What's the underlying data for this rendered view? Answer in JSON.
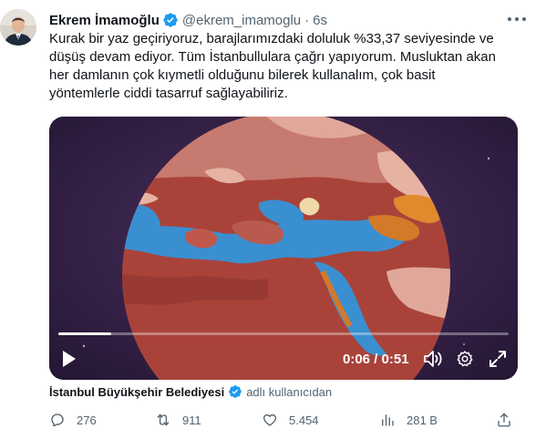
{
  "author": {
    "name": "Ekrem İmamoğlu",
    "handle": "@ekrem_imamoglu",
    "separator": "·",
    "time": "6s",
    "verified_color": "#1d9bf0"
  },
  "tweet": {
    "lines": [
      "Kurak bir yaz geçiriyoruz, barajlarımızdaki doluluk %33,37 seviyesinde ve",
      "düşüş devam ediyor. Tüm İstanbullulara çağrı yapıyorum. Musluktan akan",
      "her damlanın çok kıymetli olduğunu bilerek kullanalım, çok basit",
      "yöntemlerle ciddi tasarruf sağlayabiliriz."
    ]
  },
  "video": {
    "timecode": "0:06 / 0:51",
    "progress": 0.118,
    "icons": {
      "play": "play-icon",
      "volume": "volume-icon",
      "settings": "gear-icon",
      "fullscreen": "expand-icon"
    }
  },
  "credit": {
    "name": "İstanbul Büyükşehir Belediyesi",
    "suffix": "adlı kullanıcıdan",
    "badge_color": "#1d9bf0"
  },
  "actions": {
    "reply": "276",
    "retweet": "911",
    "like": "5.454",
    "views": "281 B",
    "icons": [
      "reply-icon",
      "retweet-icon",
      "like-icon",
      "views-icon",
      "share-icon"
    ]
  },
  "colors": {
    "text": "#0f1419",
    "muted": "#536471",
    "accent": "#1d9bf0"
  }
}
